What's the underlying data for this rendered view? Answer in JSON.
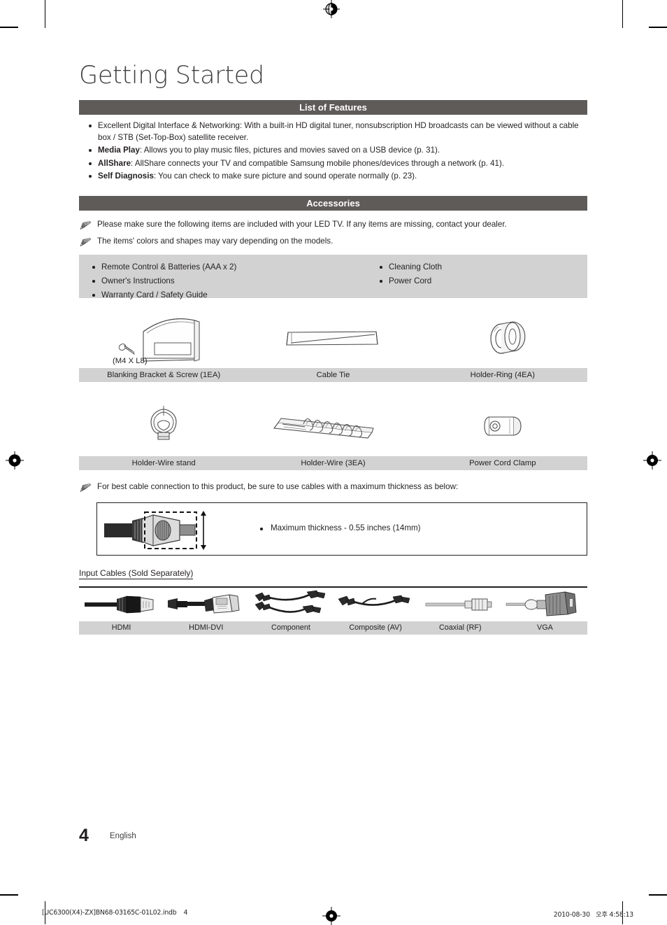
{
  "document": {
    "title": "Getting Started",
    "page_number": "4",
    "language": "English",
    "imprint_file": "[UC6300(X4)-ZX]BN68-03165C-01L02.indb",
    "imprint_page": "4",
    "imprint_date": "2010-08-30",
    "imprint_time": "오후 4:58:13"
  },
  "colors": {
    "section_bar": "#5e5b59",
    "panel_grey": "#d2d2d2",
    "text": "#231f20",
    "title": "#3f3f3f"
  },
  "features": {
    "heading": "List of Features",
    "items": [
      {
        "bold": "",
        "text": "Excellent Digital Interface & Networking: With a built-in HD digital tuner, nonsubscription HD broadcasts can be viewed without a cable box / STB (Set-Top-Box) satellite receiver."
      },
      {
        "bold": "Media Play",
        "text": ": Allows you to play music files, pictures and movies saved on a USB device (p. 31)."
      },
      {
        "bold": "AllShare",
        "text": ": AllShare connects your TV and compatible Samsung mobile phones/devices through a network (p. 41)."
      },
      {
        "bold": "Self Diagnosis",
        "text": ": You can check to make sure picture and sound operate normally (p. 23)."
      }
    ]
  },
  "accessories": {
    "heading": "Accessories",
    "notes": [
      "Please make sure the following items are included with your LED TV. If any items are missing, contact your dealer.",
      "The items' colors and shapes may vary depending on the models."
    ],
    "list_left": [
      "Remote Control & Batteries (AAA x 2)",
      "Owner's Instructions",
      "Warranty Card / Safety Guide"
    ],
    "list_right": [
      "Cleaning Cloth",
      "Power Cord"
    ],
    "screw_spec": "(M4 X L8)",
    "row1_labels": [
      "Blanking Bracket & Screw (1EA)",
      "Cable Tie",
      "Holder-Ring (4EA)"
    ],
    "row2_labels": [
      "Holder-Wire stand",
      "Holder-Wire (3EA)",
      "Power Cord Clamp"
    ]
  },
  "cable_thickness": {
    "note": "For best cable connection to this product, be sure to use cables with a maximum thickness as below:",
    "bullet": "Maximum thickness - 0.55 inches (14mm)"
  },
  "input_cables": {
    "title": "Input Cables (Sold Separately)",
    "labels": [
      "HDMI",
      "HDMI-DVI",
      "Component",
      "Composite (AV)",
      "Coaxial (RF)",
      "VGA"
    ]
  }
}
